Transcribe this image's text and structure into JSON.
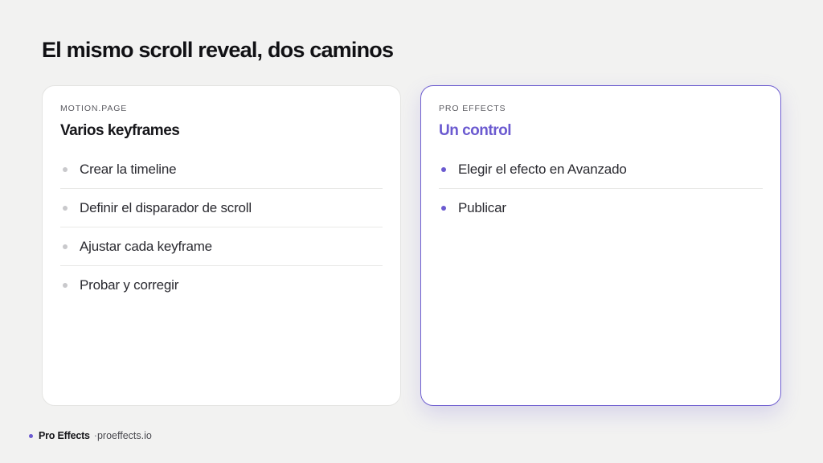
{
  "page": {
    "title": "El mismo scroll reveal, dos caminos"
  },
  "cards": {
    "left": {
      "eyebrow": "MOTION.PAGE",
      "heading": "Varios keyframes",
      "steps": [
        "Crear la timeline",
        "Definir el disparador de scroll",
        "Ajustar cada keyframe",
        "Probar y corregir"
      ]
    },
    "right": {
      "eyebrow": "PRO EFFECTS",
      "heading": "Un control",
      "steps": [
        "Elegir el efecto en Avanzado",
        "Publicar"
      ]
    }
  },
  "footer": {
    "brand": "Pro Effects",
    "separator": "·",
    "site": "proeffects.io"
  },
  "colors": {
    "accent": "#6b5ad0",
    "background": "#f2f2f1",
    "card": "#ffffff"
  }
}
